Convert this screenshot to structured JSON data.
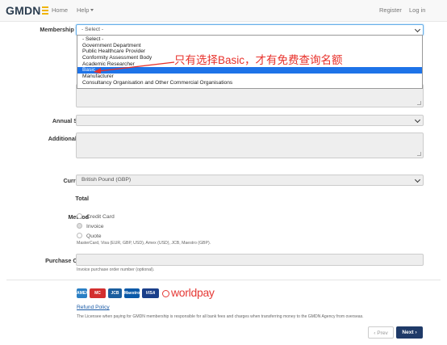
{
  "nav": {
    "logo": "GMDN",
    "home": "Home",
    "help": "Help",
    "register": "Register",
    "login": "Log in"
  },
  "form": {
    "membership_type": {
      "label": "Membership Type",
      "value": "- Select -",
      "options": [
        "- Select -",
        "Government Department",
        "Public Healthcare Provider",
        "Conformity Assessment Body",
        "Academic Researcher",
        "Basic",
        "Manufacturer",
        "Consultancy Organisation and Other Commercial Organisations"
      ],
      "highlighted_option": "Basic"
    },
    "annual_sales": {
      "label": "Annual Sales"
    },
    "additional_info": {
      "label": "Additional info"
    },
    "currency": {
      "label": "Currency",
      "value": "British Pound (GBP)"
    },
    "total": {
      "label": "Total"
    },
    "method": {
      "label": "Method",
      "options": [
        "Credit Card",
        "Invoice",
        "Quote"
      ],
      "selected": "Invoice",
      "help": "MasterCard, Visa (EUR, GBP, USD), Amex (USD), JCB, Maestro (GBP)."
    },
    "purchase_order": {
      "label": "Purchase Order",
      "help": "Invoice purchase order number (optional)."
    }
  },
  "annotation": "只有选择Basic，才有免费查询名额",
  "payment": {
    "cards": [
      "AMEX",
      "MC",
      "JCB",
      "Maestro",
      "VISA"
    ],
    "worldpay": "worldpay",
    "refund_policy": "Refund Policy",
    "notice": "The Licensee when paying for GMDN membership is responsible for all bank fees and charges when transferring money to the GMDN Agency from overseas."
  },
  "buttons": {
    "prev": "Prev",
    "next": "Next"
  },
  "colors": {
    "accent": "#1f3a68",
    "highlight": "#1e73e8",
    "annotation": "#e8312b"
  }
}
